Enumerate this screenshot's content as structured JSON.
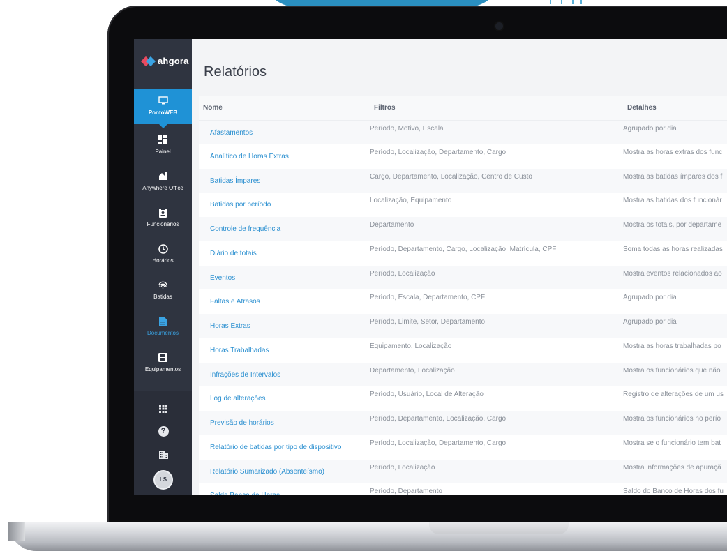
{
  "app": {
    "logo_text": "ahgora",
    "page_title": "Relatórios"
  },
  "sidebar": {
    "items": [
      {
        "label": "PontoWEB",
        "icon": "monitor-icon",
        "active": true
      },
      {
        "label": "Painel",
        "icon": "dashboard-icon"
      },
      {
        "label": "Anywhere Office",
        "icon": "home-office-icon"
      },
      {
        "label": "Funcionários",
        "icon": "badge-icon"
      },
      {
        "label": "Horários",
        "icon": "clock-icon"
      },
      {
        "label": "Batidas",
        "icon": "fingerprint-icon"
      },
      {
        "label": "Documentos",
        "icon": "document-icon",
        "highlighted": true
      },
      {
        "label": "Equipamentos",
        "icon": "device-icon"
      }
    ],
    "bottom": {
      "apps_icon": "grid-icon",
      "help_icon": "help-icon",
      "company_icon": "building-icon",
      "avatar_initials": "LS"
    }
  },
  "table": {
    "headers": [
      "Nome",
      "Filtros",
      "Detalhes"
    ],
    "rows": [
      {
        "nome": "Afastamentos",
        "filtros": "Período, Motivo, Escala",
        "detalhes": "Agrupado por dia"
      },
      {
        "nome": "Analítico de Horas Extras",
        "filtros": "Período, Localização, Departamento, Cargo",
        "detalhes": "Mostra as horas extras dos func"
      },
      {
        "nome": "Batidas Ímpares",
        "filtros": "Cargo, Departamento, Localização, Centro de Custo",
        "detalhes": "Mostra as batidas ímpares dos f"
      },
      {
        "nome": "Batidas por período",
        "filtros": "Localização, Equipamento",
        "detalhes": "Mostra as batidas dos funcionár"
      },
      {
        "nome": "Controle de frequência",
        "filtros": "Departamento",
        "detalhes": "Mostra os totais, por departame"
      },
      {
        "nome": "Diário de totais",
        "filtros": "Período, Departamento, Cargo, Localização, Matrícula, CPF",
        "detalhes": "Soma todas as horas realizadas"
      },
      {
        "nome": "Eventos",
        "filtros": "Período, Localização",
        "detalhes": "Mostra eventos relacionados ao"
      },
      {
        "nome": "Faltas e Atrasos",
        "filtros": "Período, Escala, Departamento, CPF",
        "detalhes": "Agrupado por dia"
      },
      {
        "nome": "Horas Extras",
        "filtros": "Período, Limite, Setor, Departamento",
        "detalhes": "Agrupado por dia"
      },
      {
        "nome": "Horas Trabalhadas",
        "filtros": "Equipamento, Localização",
        "detalhes": "Mostra as horas trabalhadas po"
      },
      {
        "nome": "Infrações de Intervalos",
        "filtros": "Departamento, Localização",
        "detalhes": "Mostra os funcionários que não"
      },
      {
        "nome": "Log de alterações",
        "filtros": "Período, Usuário, Local de Alteração",
        "detalhes": "Registro de alterações de um us"
      },
      {
        "nome": "Previsão de horários",
        "filtros": "Período, Departamento, Localização, Cargo",
        "detalhes": "Mostra os funcionários no perío"
      },
      {
        "nome": "Relatório de batidas por tipo de dispositivo",
        "filtros": "Período, Localização, Departamento, Cargo",
        "detalhes": "Mostra se o funcionário tem bat"
      },
      {
        "nome": "Relatório Sumarizado (Absenteísmo)",
        "filtros": "Período, Localização",
        "detalhes": "Mostra informações de apuraçã"
      },
      {
        "nome": "Saldo Banco de Horas",
        "filtros": "Período, Departamento",
        "detalhes": "Saldo do Banco de Horas dos fu"
      }
    ]
  }
}
